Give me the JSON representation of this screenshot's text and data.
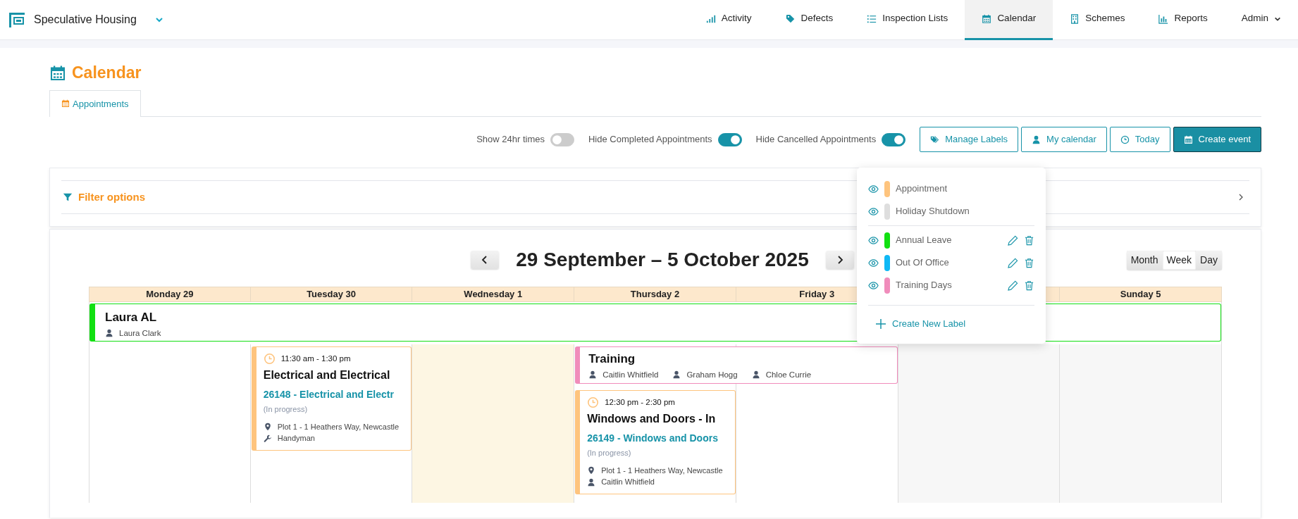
{
  "app": {
    "title": "Speculative Housing"
  },
  "nav": [
    {
      "label": "Activity",
      "selected": false
    },
    {
      "label": "Defects",
      "selected": false
    },
    {
      "label": "Inspection Lists",
      "selected": false
    },
    {
      "label": "Calendar",
      "selected": true
    },
    {
      "label": "Schemes",
      "selected": false
    },
    {
      "label": "Reports",
      "selected": false
    }
  ],
  "user_menu": {
    "label": "Admin"
  },
  "page": {
    "title": "Calendar"
  },
  "tabs": [
    {
      "label": "Appointments",
      "selected": true
    }
  ],
  "toggles": [
    {
      "label": "Show 24hr times",
      "on": false
    },
    {
      "label": "Hide Completed Appointments",
      "on": true
    },
    {
      "label": "Hide Cancelled Appointments",
      "on": true
    }
  ],
  "buttons": [
    {
      "label": "Manage Labels",
      "primary": false
    },
    {
      "label": "My calendar",
      "primary": false
    },
    {
      "label": "Today",
      "primary": false
    },
    {
      "label": "Create event",
      "primary": true
    }
  ],
  "filter": {
    "label": "Filter options"
  },
  "labels_menu": {
    "groups": [
      [
        {
          "name": "Appointment",
          "color": "#fec47e",
          "editable": false
        },
        {
          "name": "Holiday Shutdown",
          "color": "#dedede",
          "editable": false
        }
      ],
      [
        {
          "name": "Annual Leave",
          "color": "#12e012",
          "editable": true
        },
        {
          "name": "Out Of Office",
          "color": "#0fb8f5",
          "editable": true
        },
        {
          "name": "Training Days",
          "color": "#f08cbb",
          "editable": true
        }
      ]
    ],
    "create": "Create New Label"
  },
  "week": {
    "title": "29 September – 5 October 2025"
  },
  "views": [
    {
      "label": "Month",
      "selected": false
    },
    {
      "label": "Week",
      "selected": true
    },
    {
      "label": "Day",
      "selected": false
    }
  ],
  "days": [
    {
      "label": "Monday 29",
      "kind": "weekday"
    },
    {
      "label": "Tuesday 30",
      "kind": "weekday"
    },
    {
      "label": "Wednesday 1",
      "kind": "today"
    },
    {
      "label": "Thursday 2",
      "kind": "weekday"
    },
    {
      "label": "Friday 3",
      "kind": "weekday"
    },
    {
      "kind": "weekend"
    },
    {
      "label": "Sunday 5",
      "kind": "weekend"
    }
  ],
  "all_day_events": [
    {
      "title": "Laura AL",
      "color": "#12e012",
      "people": [
        "Laura Clark"
      ]
    }
  ],
  "events": [
    {
      "kind": "appointment",
      "color": "#fec47e",
      "time": "11:30 am - 1:30 pm",
      "title": "Electrical and Electrical",
      "job": "26148 - Electrical and Electr",
      "status": "(In progress)",
      "details": [
        {
          "kind": "location",
          "text": "Plot 1 - 1 Heathers Way, Newcastle"
        },
        {
          "kind": "tool",
          "text": "Handyman"
        }
      ]
    },
    {
      "kind": "label",
      "color": "#f08cbb",
      "title": "Training",
      "people": [
        "Caitlin Whitfield",
        "Graham Hogg",
        "Chloe Currie"
      ]
    },
    {
      "kind": "appointment",
      "color": "#fec47e",
      "time": "12:30 pm - 2:30 pm",
      "title": "Windows and Doors - In",
      "job": "26149 - Windows and Doors",
      "status": "(In progress)",
      "details": [
        {
          "kind": "location",
          "text": "Plot 1 - 1 Heathers Way, Newcastle"
        },
        {
          "kind": "person",
          "text": "Caitlin Whitfield"
        }
      ]
    }
  ]
}
